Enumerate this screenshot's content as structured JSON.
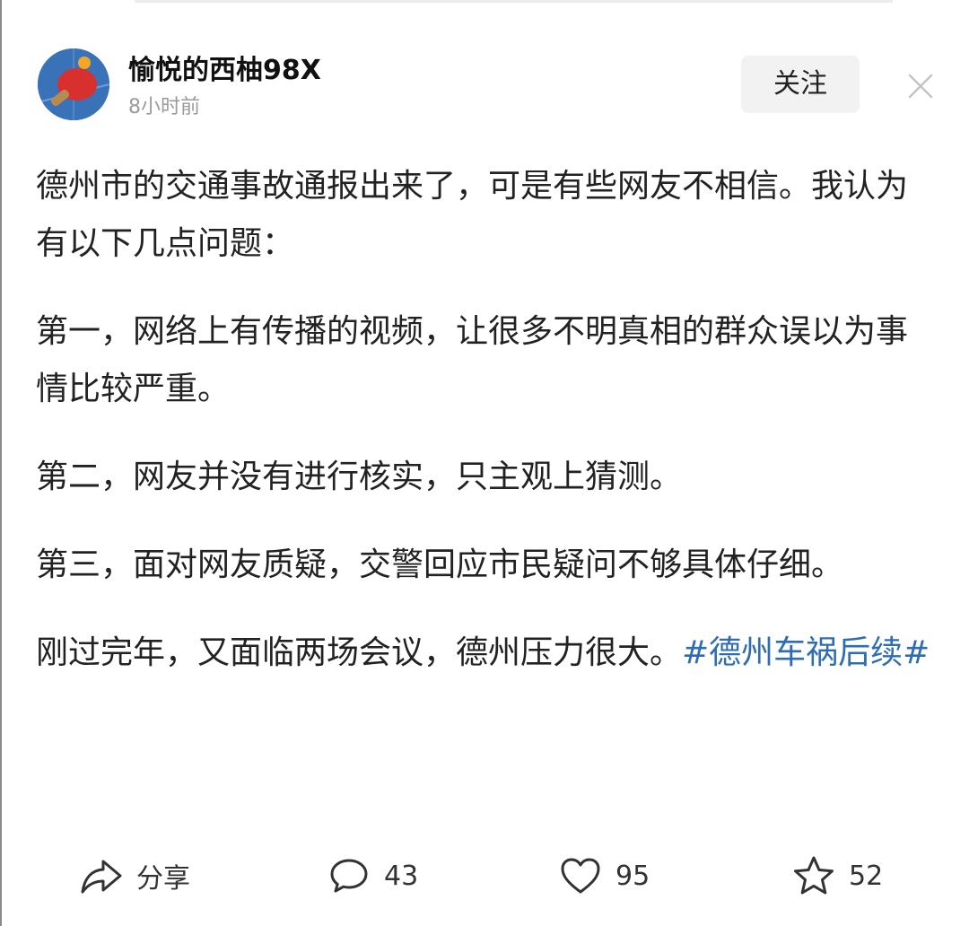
{
  "author": {
    "name": "愉悦的西柚98X",
    "time": "8小时前",
    "avatar_icon": "ping-pong-paddle-icon"
  },
  "header": {
    "follow_label": "关注",
    "close_icon": "close-icon"
  },
  "post": {
    "paragraphs": [
      "德州市的交通事故通报出来了，可是有些网友不相信。我认为有以下几点问题：",
      "第一，网络上有传播的视频，让很多不明真相的群众误以为事情比较严重。",
      "第二，网友并没有进行核实，只主观上猜测。",
      "第三，面对网友质疑，交警回应市民疑问不够具体仔细。"
    ],
    "last_paragraph_text": "刚过完年，又面临两场会议，德州压力很大。",
    "hashtag": "#德州车祸后续#",
    "hashtag_color": "#2e6db4"
  },
  "actions": {
    "share": {
      "label": "分享",
      "icon": "share-icon"
    },
    "comment": {
      "count": "43",
      "icon": "comment-icon"
    },
    "like": {
      "count": "95",
      "icon": "heart-icon"
    },
    "favorite": {
      "count": "52",
      "icon": "star-icon"
    }
  }
}
